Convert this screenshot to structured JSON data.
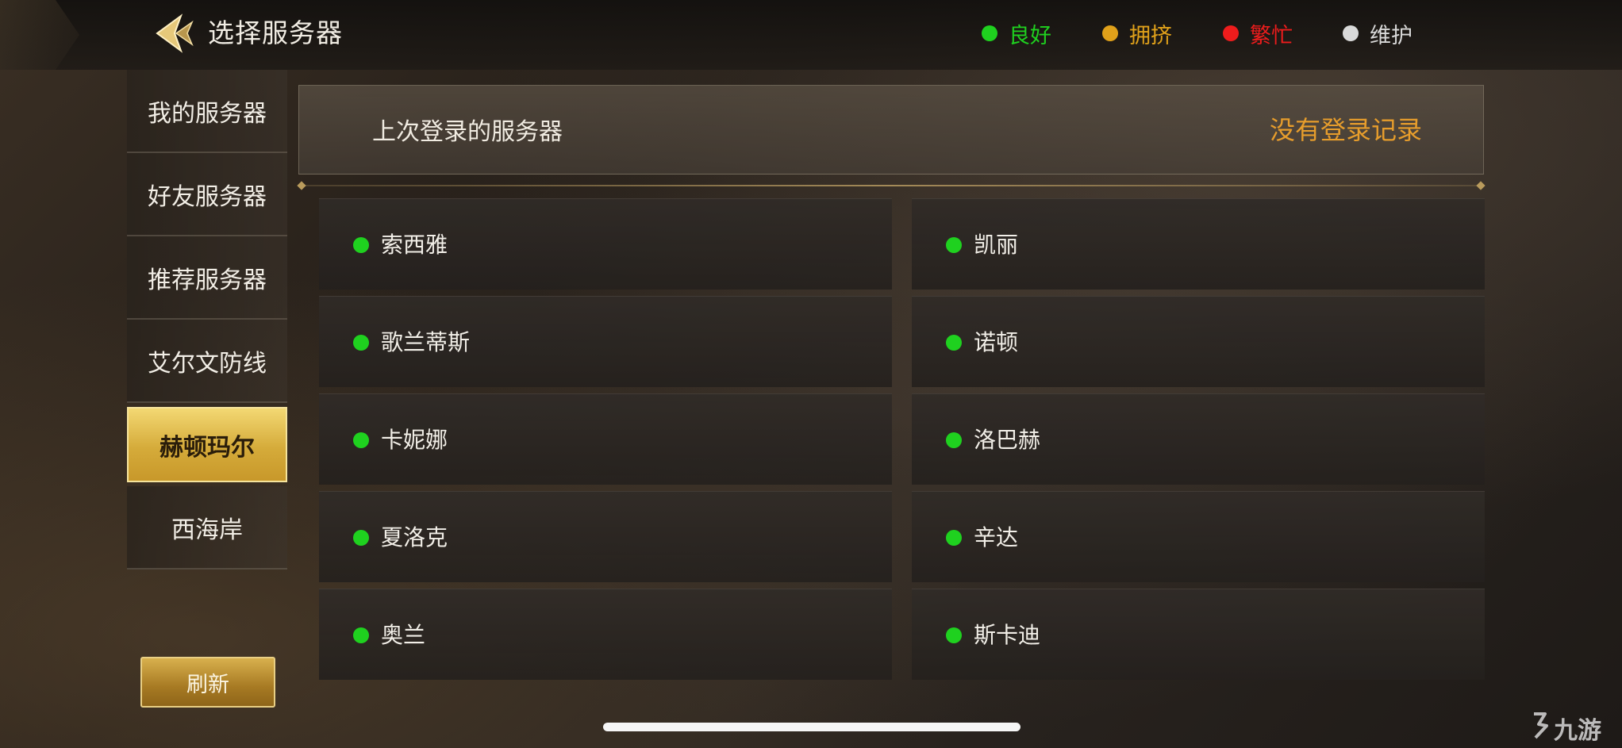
{
  "header": {
    "title": "选择服务器",
    "legend": [
      {
        "label": "良好",
        "color": "#1fd11f"
      },
      {
        "label": "拥挤",
        "color": "#e0a11a"
      },
      {
        "label": "繁忙",
        "color": "#ee1c1c"
      },
      {
        "label": "维护",
        "color": "#d9d9d9"
      }
    ]
  },
  "sidebar": {
    "items": [
      {
        "label": "我的服务器",
        "active": false
      },
      {
        "label": "好友服务器",
        "active": false
      },
      {
        "label": "推荐服务器",
        "active": false
      },
      {
        "label": "艾尔文防线",
        "active": false
      },
      {
        "label": "赫顿玛尔",
        "active": true
      },
      {
        "label": "西海岸",
        "active": false
      }
    ],
    "refresh_label": "刷新"
  },
  "last_login": {
    "label": "上次登录的服务器",
    "value": "没有登录记录"
  },
  "servers": [
    {
      "name": "索西雅",
      "status": "良好"
    },
    {
      "name": "凯丽",
      "status": "良好"
    },
    {
      "name": "歌兰蒂斯",
      "status": "良好"
    },
    {
      "name": "诺顿",
      "status": "良好"
    },
    {
      "name": "卡妮娜",
      "status": "良好"
    },
    {
      "name": "洛巴赫",
      "status": "良好"
    },
    {
      "name": "夏洛克",
      "status": "良好"
    },
    {
      "name": "辛达",
      "status": "良好"
    },
    {
      "name": "奥兰",
      "status": "良好"
    },
    {
      "name": "斯卡迪",
      "status": "良好"
    }
  ],
  "watermark": "九游"
}
